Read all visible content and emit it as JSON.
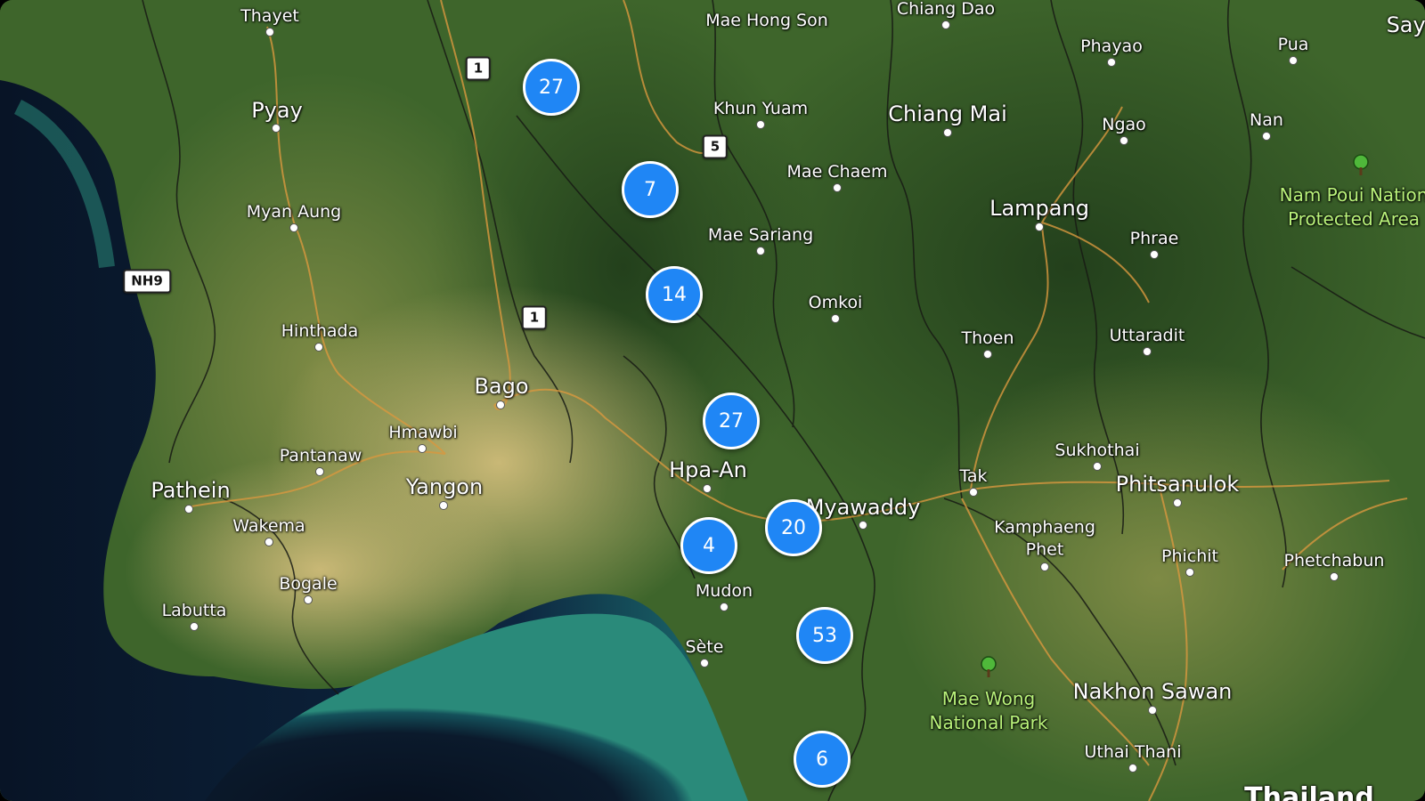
{
  "map": {
    "colors": {
      "water_deep": "#0b1a2c",
      "water_shallow": "#1f7b77",
      "land": "#3f6a2c",
      "plains": "#b8a45c",
      "cluster": "#1f86f5",
      "border": "#1a1a1a",
      "road": "#e0a24a",
      "park_text": "#b9f27a"
    },
    "places": [
      {
        "id": "thayet",
        "label": "Thayet"
      },
      {
        "id": "pyay",
        "label": "Pyay"
      },
      {
        "id": "myan-aung",
        "label": "Myan Aung"
      },
      {
        "id": "hinthada",
        "label": "Hinthada"
      },
      {
        "id": "bago",
        "label": "Bago"
      },
      {
        "id": "hmawbi",
        "label": "Hmawbi"
      },
      {
        "id": "pantanaw",
        "label": "Pantanaw"
      },
      {
        "id": "pathein",
        "label": "Pathein"
      },
      {
        "id": "yangon",
        "label": "Yangon"
      },
      {
        "id": "wakema",
        "label": "Wakema"
      },
      {
        "id": "bogale",
        "label": "Bogale"
      },
      {
        "id": "labutta",
        "label": "Labutta"
      },
      {
        "id": "hpa-an",
        "label": "Hpa-An"
      },
      {
        "id": "mudon",
        "label": "Mudon"
      },
      {
        "id": "sete",
        "label": "Sète"
      },
      {
        "id": "myawaddy",
        "label": "Myawaddy"
      },
      {
        "id": "mae-hong-son",
        "label": "Mae Hong Son"
      },
      {
        "id": "chiang-dao",
        "label": "Chiang Dao"
      },
      {
        "id": "khun-yuam",
        "label": "Khun Yuam"
      },
      {
        "id": "chiang-mai",
        "label": "Chiang Mai"
      },
      {
        "id": "mae-chaem",
        "label": "Mae Chaem"
      },
      {
        "id": "mae-sariang",
        "label": "Mae Sariang"
      },
      {
        "id": "omkoi",
        "label": "Omkoi"
      },
      {
        "id": "phayao",
        "label": "Phayao"
      },
      {
        "id": "ngao",
        "label": "Ngao"
      },
      {
        "id": "lampang",
        "label": "Lampang"
      },
      {
        "id": "pua",
        "label": "Pua"
      },
      {
        "id": "nan",
        "label": "Nan"
      },
      {
        "id": "phrae",
        "label": "Phrae"
      },
      {
        "id": "thoen",
        "label": "Thoen"
      },
      {
        "id": "uttaradit",
        "label": "Uttaradit"
      },
      {
        "id": "sukhothai",
        "label": "Sukhothai"
      },
      {
        "id": "tak",
        "label": "Tak"
      },
      {
        "id": "phitsanulok",
        "label": "Phitsanulok"
      },
      {
        "id": "kamphaeng-phet",
        "label": "Kamphaeng\nPhet"
      },
      {
        "id": "phichit",
        "label": "Phichit"
      },
      {
        "id": "phetchabun",
        "label": "Phetchabun"
      },
      {
        "id": "nakhon-sawan",
        "label": "Nakhon Sawan"
      },
      {
        "id": "uthai-thani",
        "label": "Uthai Thani"
      },
      {
        "id": "saya",
        "label": "Saya"
      },
      {
        "id": "thailand",
        "label": "Thailand"
      }
    ],
    "parks": [
      {
        "id": "nam-poui",
        "line1": "Nam Poui Nation",
        "line2": "Protected Area"
      },
      {
        "id": "mae-wong",
        "line1": "Mae Wong",
        "line2": "National Park"
      }
    ],
    "shields": [
      {
        "id": "route-1-north",
        "label": "1"
      },
      {
        "id": "route-5",
        "label": "5"
      },
      {
        "id": "nh9",
        "label": "NH9"
      },
      {
        "id": "route-1-south",
        "label": "1"
      }
    ],
    "clusters": [
      {
        "id": "a",
        "count": "27"
      },
      {
        "id": "b",
        "count": "7"
      },
      {
        "id": "c",
        "count": "14"
      },
      {
        "id": "d",
        "count": "27"
      },
      {
        "id": "e",
        "count": "20"
      },
      {
        "id": "f",
        "count": "4"
      },
      {
        "id": "g",
        "count": "53"
      },
      {
        "id": "h",
        "count": "6"
      }
    ]
  }
}
